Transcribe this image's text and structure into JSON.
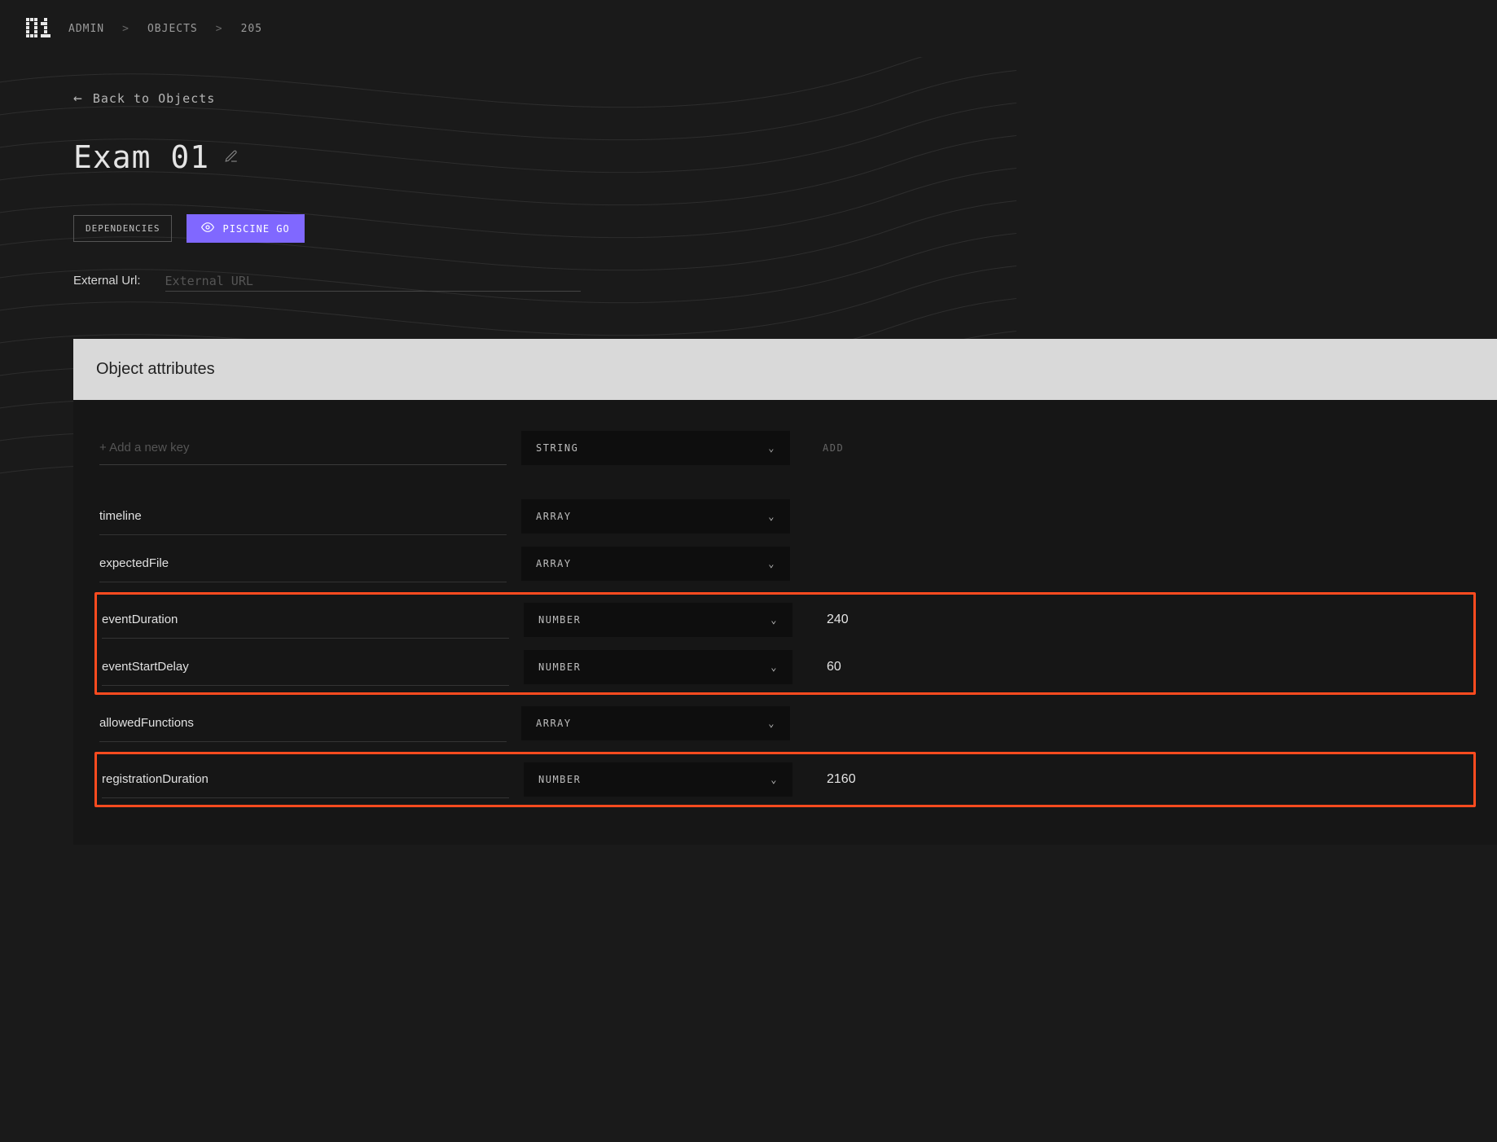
{
  "breadcrumb": {
    "items": [
      "ADMIN",
      "OBJECTS",
      "205"
    ]
  },
  "backLink": "Back to Objects",
  "pageTitle": "Exam 01",
  "buttons": {
    "dependencies": "DEPENDENCIES",
    "piscine": "PISCINE GO"
  },
  "externalUrl": {
    "label": "External Url:",
    "placeholder": "External URL",
    "value": ""
  },
  "section": {
    "title": "Object attributes"
  },
  "addRow": {
    "placeholder": "+ Add a new key",
    "type": "STRING",
    "addLabel": "ADD"
  },
  "attributes": [
    {
      "key": "timeline",
      "type": "ARRAY",
      "value": "",
      "highlight": null
    },
    {
      "key": "expectedFile",
      "type": "ARRAY",
      "value": "",
      "highlight": null
    },
    {
      "key": "eventDuration",
      "type": "NUMBER",
      "value": "240",
      "highlight": "a"
    },
    {
      "key": "eventStartDelay",
      "type": "NUMBER",
      "value": "60",
      "highlight": "a"
    },
    {
      "key": "allowedFunctions",
      "type": "ARRAY",
      "value": "",
      "highlight": null
    },
    {
      "key": "registrationDuration",
      "type": "NUMBER",
      "value": "2160",
      "highlight": "b"
    }
  ]
}
